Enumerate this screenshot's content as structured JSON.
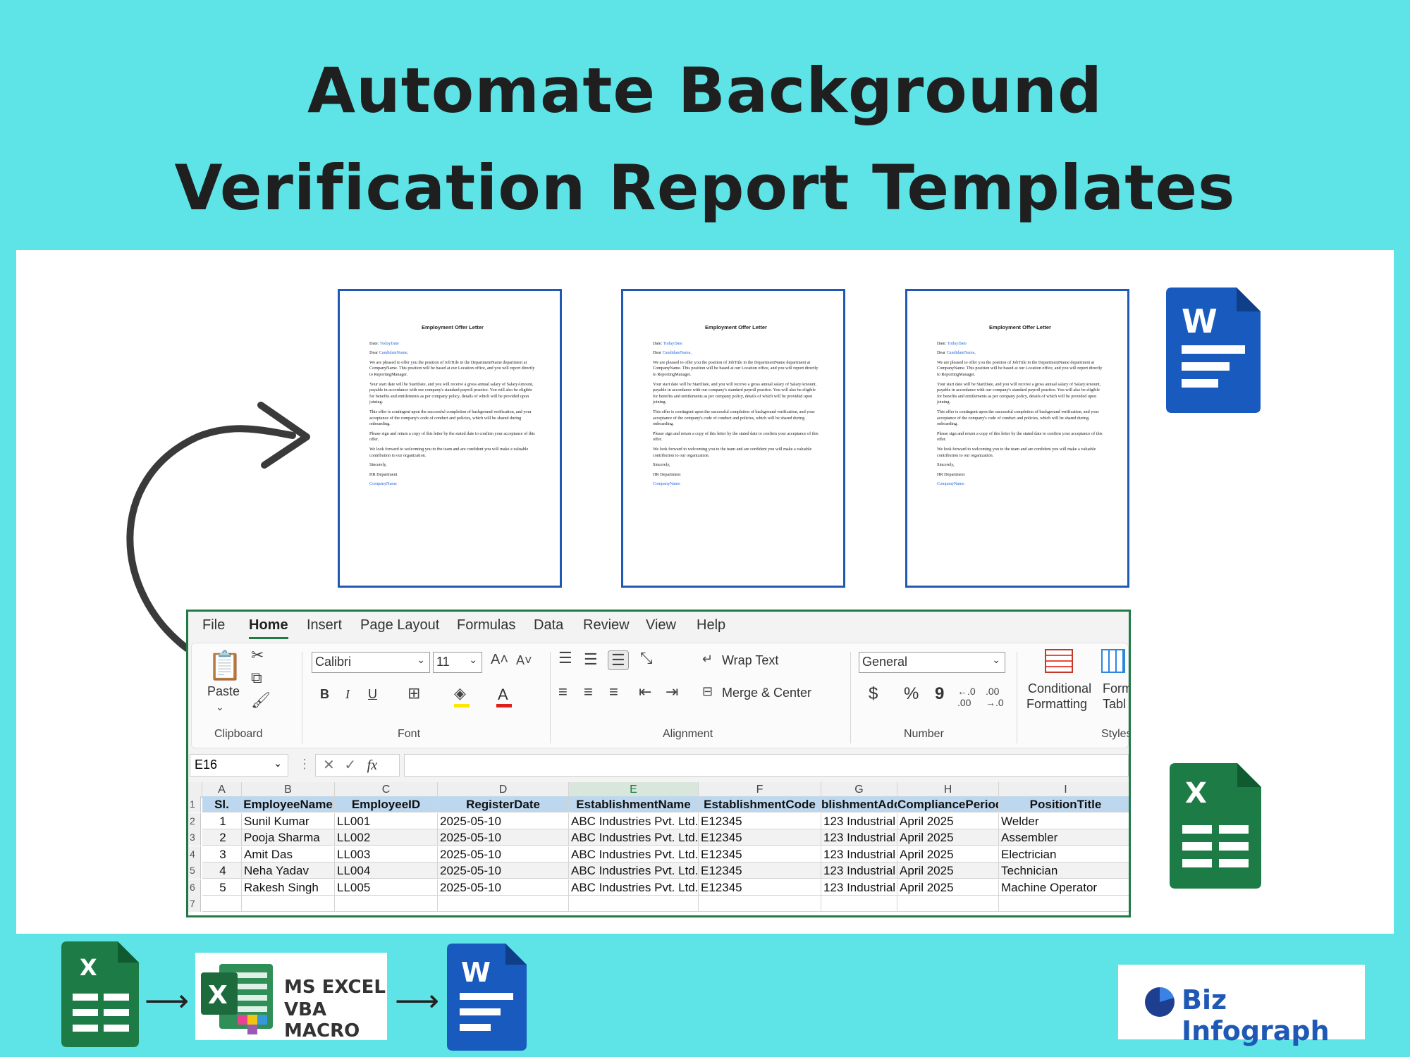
{
  "title": {
    "line1": "Automate Background",
    "line2": "Verification Report Templates"
  },
  "colors": {
    "background": "#5ee3e6",
    "word_blue": "#185abd",
    "excel_green": "#1f7a45",
    "header_fill": "#bdd7ee"
  },
  "document": {
    "title": "Employment Offer Letter",
    "date_label": "Date:",
    "date_field": "TodayDate",
    "dear_label": "Dear",
    "candidate_field": "CandidateName,",
    "p1": "We are pleased to offer you the position of JobTitle in the DepartmentName department at CompanyName. This position will be based at our Location office, and you will report directly to ReportingManager.",
    "p2": "Your start date will be StartDate, and you will receive a gross annual salary of SalaryAmount, payable in accordance with our company's standard payroll practice. You will also be eligible for benefits and entitlements as per company policy, details of which will be provided upon joining.",
    "p3": "This offer is contingent upon the successful completion of background verification, and your acceptance of the company's code of conduct and policies, which will be shared during onboarding.",
    "p4": "Please sign and return a copy of this letter by the stated date to confirm your acceptance of this offer.",
    "p5": "We look forward to welcoming you to the team and are confident you will make a valuable contribution to our organization.",
    "sincerely": "Sincerely,",
    "dept": "HR Department",
    "company_field": "CompanyName"
  },
  "icons": {
    "word_letter": "W",
    "excel_letter": "X"
  },
  "excel": {
    "menu": [
      "File",
      "Home",
      "Insert",
      "Page Layout",
      "Formulas",
      "Data",
      "Review",
      "View",
      "Help"
    ],
    "active_tab": "Home",
    "ribbon": {
      "paste": "Paste",
      "font_name": "Calibri",
      "font_size": "11",
      "bold": "B",
      "italic": "I",
      "underline": "U",
      "wrap_text": "Wrap Text",
      "merge_center": "Merge & Center",
      "number_format": "General",
      "currency": "$",
      "percent": "%",
      "comma": "9",
      "conditional_1": "Conditional",
      "conditional_2": "Formatting",
      "format_table_1": "Form",
      "format_table_2": "Tabl",
      "groups": {
        "clipboard": "Clipboard",
        "font": "Font",
        "alignment": "Alignment",
        "number": "Number",
        "styles": "Styles"
      }
    },
    "name_box": "E16",
    "fx": "fx",
    "columns": [
      "A",
      "B",
      "C",
      "D",
      "E",
      "F",
      "G",
      "H",
      "I"
    ],
    "row_numbers": [
      "1",
      "2",
      "3",
      "4",
      "5",
      "6",
      "7"
    ],
    "headers": [
      "Sl.",
      "EmployeeName",
      "EmployeeID",
      "RegisterDate",
      "EstablishmentName",
      "EstablishmentCode",
      "blishmentAdd",
      "CompliancePeriod",
      "PositionTitle"
    ],
    "rows": [
      [
        "1",
        "Sunil Kumar",
        "LL001",
        "2025-05-10",
        "ABC Industries Pvt. Ltd.",
        "E12345",
        "123 Industrial",
        "April 2025",
        "Welder"
      ],
      [
        "2",
        "Pooja Sharma",
        "LL002",
        "2025-05-10",
        "ABC Industries Pvt. Ltd.",
        "E12345",
        "123 Industrial",
        "April 2025",
        "Assembler"
      ],
      [
        "3",
        "Amit Das",
        "LL003",
        "2025-05-10",
        "ABC Industries Pvt. Ltd.",
        "E12345",
        "123 Industrial",
        "April 2025",
        "Electrician"
      ],
      [
        "4",
        "Neha Yadav",
        "LL004",
        "2025-05-10",
        "ABC Industries Pvt. Ltd.",
        "E12345",
        "123 Industrial",
        "April 2025",
        "Technician"
      ],
      [
        "5",
        "Rakesh Singh",
        "LL005",
        "2025-05-10",
        "ABC Industries Pvt. Ltd.",
        "E12345",
        "123 Industrial",
        "April 2025",
        "Machine Operator"
      ]
    ]
  },
  "flow": {
    "vba_line1": "MS EXCEL",
    "vba_line2": "VBA MACRO",
    "arrow": "⟶"
  },
  "brand": {
    "name": "Biz Infograph"
  }
}
